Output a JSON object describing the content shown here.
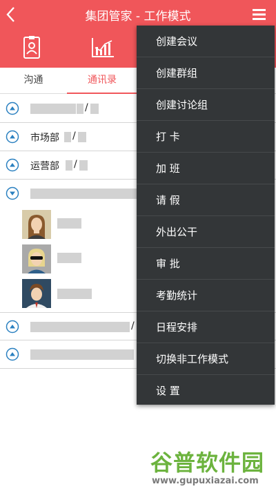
{
  "header": {
    "title": "集团管家 - 工作模式",
    "back_icon": "chevron-left-icon",
    "menu_icon": "hamburger-menu-icon"
  },
  "colors": {
    "brand": "#f0565a",
    "popup_bg": "#333638",
    "watermark_green": "#6cb33e",
    "placeholder": "#d2d2d2"
  },
  "iconbar": {
    "icons": [
      "id-card-icon",
      "chart-icon"
    ]
  },
  "tabs": [
    {
      "label": "沟通"
    },
    {
      "label": "通讯录"
    }
  ],
  "contacts": {
    "groups": [
      {
        "name": "",
        "slash": "/",
        "state": "collapsed"
      },
      {
        "name": "市场部",
        "slash": "/",
        "state": "collapsed"
      },
      {
        "name": "运营部",
        "slash": "/",
        "state": "collapsed"
      },
      {
        "name": "",
        "slash": "",
        "state": "expanded"
      },
      {
        "name": "",
        "slash": "/",
        "state": "collapsed"
      },
      {
        "name": "",
        "slash": "",
        "state": "collapsed"
      }
    ],
    "members": [
      {
        "avatar": "female-avatar-icon"
      },
      {
        "avatar": "sunglasses-avatar-icon"
      },
      {
        "avatar": "male-avatar-icon"
      }
    ]
  },
  "popup_menu": {
    "items": [
      {
        "label": "创建会议"
      },
      {
        "label": "创建群组"
      },
      {
        "label": "创建讨论组"
      },
      {
        "label": "打 卡"
      },
      {
        "label": "加 班"
      },
      {
        "label": "请 假"
      },
      {
        "label": "外出公干"
      },
      {
        "label": "审 批"
      },
      {
        "label": "考勤统计"
      },
      {
        "label": "日程安排"
      },
      {
        "label": "切换非工作模式"
      },
      {
        "label": "设 置"
      }
    ]
  },
  "watermark": {
    "title": "谷普软件园",
    "url": "www.gupuxiazai.com"
  }
}
